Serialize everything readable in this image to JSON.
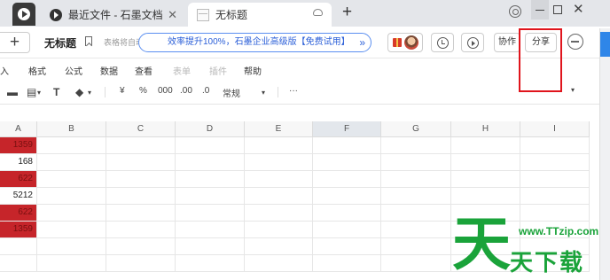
{
  "tabs": [
    {
      "label": "最近文件 - 石墨文档"
    },
    {
      "label": "无标题"
    }
  ],
  "header": {
    "title": "无标题",
    "autosave_text": "表格将自动保存",
    "promo_text": "效率提升100%，石墨企业高级版【免费试用】",
    "promo_arrow": "»",
    "collab_label": "协作",
    "share_label": "分享"
  },
  "menu": {
    "items": [
      "入",
      "格式",
      "公式",
      "数据",
      "查看",
      "表单",
      "插件",
      "帮助"
    ]
  },
  "toolbar": {
    "currency": "¥",
    "percent": "%",
    "thousands": "000",
    "dec_add": ".00",
    "dec_remove": ".0",
    "format_label": "常规",
    "more_label": "···"
  },
  "sheet": {
    "columns": [
      "A",
      "B",
      "C",
      "D",
      "E",
      "F",
      "G",
      "H",
      "I"
    ],
    "selected_column": "F",
    "column_a_values": [
      "1359",
      "168",
      "622",
      "5212",
      "622",
      "1359"
    ],
    "highlighted_rows": [
      0,
      2,
      4,
      5
    ],
    "highlight_color": "#c6252a"
  },
  "watermark": {
    "glyph": "天",
    "url": "www.TTzip.com",
    "name": "天下载"
  },
  "colors": {
    "accent_blue": "#2b5fd8",
    "highlight_box": "#e0141c",
    "watermark_green": "#1aa33a"
  }
}
